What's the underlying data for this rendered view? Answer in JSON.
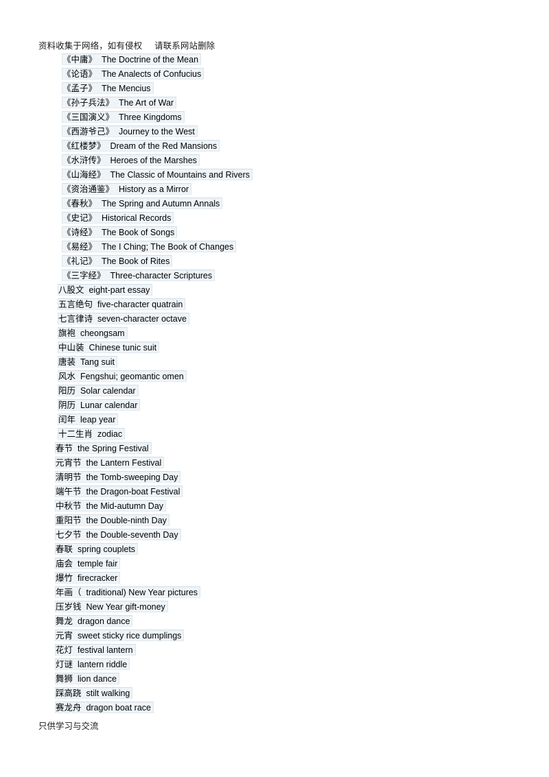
{
  "document": {
    "header_note": "资料收集于网络，如有侵权     请联系网站删除",
    "footer_note": "只供学习与交流",
    "colors": {
      "page_background": "#ffffff",
      "cell_background": "#eef4f8",
      "cell_border_top": "#d2dde4",
      "cell_border_side": "#dde5ea",
      "text": "#000000"
    }
  },
  "glossary": {
    "entries": [
      {
        "term": "《中庸》",
        "gloss": "The Doctrine of the Mean",
        "indent": 28
      },
      {
        "term": "《论语》",
        "gloss": "The Analects of Confucius",
        "indent": 28
      },
      {
        "term": "《孟子》",
        "gloss": "The Mencius",
        "indent": 28
      },
      {
        "term": "《孙子兵法》",
        "gloss": "The Art of War",
        "indent": 28
      },
      {
        "term": "《三国演义》",
        "gloss": "Three Kingdoms",
        "indent": 28
      },
      {
        "term": "《西游爷己》",
        "gloss": "Journey to the West",
        "indent": 28
      },
      {
        "term": "《红楼梦》",
        "gloss": "Dream of the Red Mansions",
        "indent": 28
      },
      {
        "term": "《水浒传》",
        "gloss": "Heroes of the Marshes",
        "indent": 28
      },
      {
        "term": "《山海经》",
        "gloss": "The Classic of Mountains and Rivers",
        "indent": 28
      },
      {
        "term": "《资治通鉴》",
        "gloss": "History as a Mirror",
        "indent": 28
      },
      {
        "term": "《春秋》",
        "gloss": "The Spring and Autumn Annals",
        "indent": 28
      },
      {
        "term": "《史记》",
        "gloss": "Historical Records",
        "indent": 28
      },
      {
        "term": "《诗经》",
        "gloss": "The Book of Songs",
        "indent": 28
      },
      {
        "term": "《易经》",
        "gloss": "The I Ching; The Book of Changes",
        "indent": 28
      },
      {
        "term": "《礼记》",
        "gloss": "The Book of Rites",
        "indent": 28
      },
      {
        "term": "《三字经》",
        "gloss": "Three-character Scriptures",
        "indent": 28
      },
      {
        "term": "八股文",
        "gloss": "eight-part essay",
        "indent": 22
      },
      {
        "term": "五言绝句",
        "gloss": "five-character quatrain",
        "indent": 22
      },
      {
        "term": "七言律诗",
        "gloss": "seven-character octave",
        "indent": 22
      },
      {
        "term": "旗袍",
        "gloss": "cheongsam",
        "indent": 22
      },
      {
        "term": "中山装",
        "gloss": "Chinese tunic suit",
        "indent": 22
      },
      {
        "term": "唐装",
        "gloss": "Tang suit",
        "indent": 22
      },
      {
        "term": "风水",
        "gloss": "Fengshui; geomantic omen",
        "indent": 22
      },
      {
        "term": "阳历",
        "gloss": "Solar calendar",
        "indent": 22
      },
      {
        "term": "阴历",
        "gloss": "Lunar calendar",
        "indent": 22
      },
      {
        "term": "闰年",
        "gloss": "leap year",
        "indent": 22
      },
      {
        "term": "十二生肖",
        "gloss": "zodiac",
        "indent": 22
      },
      {
        "term": "春节",
        "gloss": "the Spring Festival",
        "indent": 18
      },
      {
        "term": "元宵节",
        "gloss": "the Lantern Festival",
        "indent": 18
      },
      {
        "term": "清明节",
        "gloss": "the Tomb-sweeping Day",
        "indent": 18
      },
      {
        "term": "端午节",
        "gloss": "the Dragon-boat Festival",
        "indent": 18
      },
      {
        "term": "中秋节",
        "gloss": "the Mid-autumn Day",
        "indent": 18
      },
      {
        "term": "重阳节",
        "gloss": "the Double-ninth Day",
        "indent": 18
      },
      {
        "term": "七夕节",
        "gloss": "the Double-seventh Day",
        "indent": 18
      },
      {
        "term": "春联",
        "gloss": "spring couplets",
        "indent": 18
      },
      {
        "term": "庙会",
        "gloss": "temple fair",
        "indent": 18
      },
      {
        "term": "爆竹",
        "gloss": "firecracker",
        "indent": 18
      },
      {
        "term": "年画（",
        "gloss": "traditional) New Year pictures",
        "indent": 18
      },
      {
        "term": "压岁钱",
        "gloss": "New Year gift-money",
        "indent": 18
      },
      {
        "term": "舞龙",
        "gloss": "dragon dance",
        "indent": 18
      },
      {
        "term": "元宵",
        "gloss": "sweet sticky rice dumplings",
        "indent": 18
      },
      {
        "term": "花灯",
        "gloss": "festival lantern",
        "indent": 18
      },
      {
        "term": "灯谜",
        "gloss": "lantern riddle",
        "indent": 18
      },
      {
        "term": "舞狮",
        "gloss": "lion dance",
        "indent": 18
      },
      {
        "term": "踩高跷",
        "gloss": "stilt walking",
        "indent": 18
      },
      {
        "term": "赛龙舟",
        "gloss": "dragon boat race",
        "indent": 18
      }
    ],
    "gap": "  "
  }
}
